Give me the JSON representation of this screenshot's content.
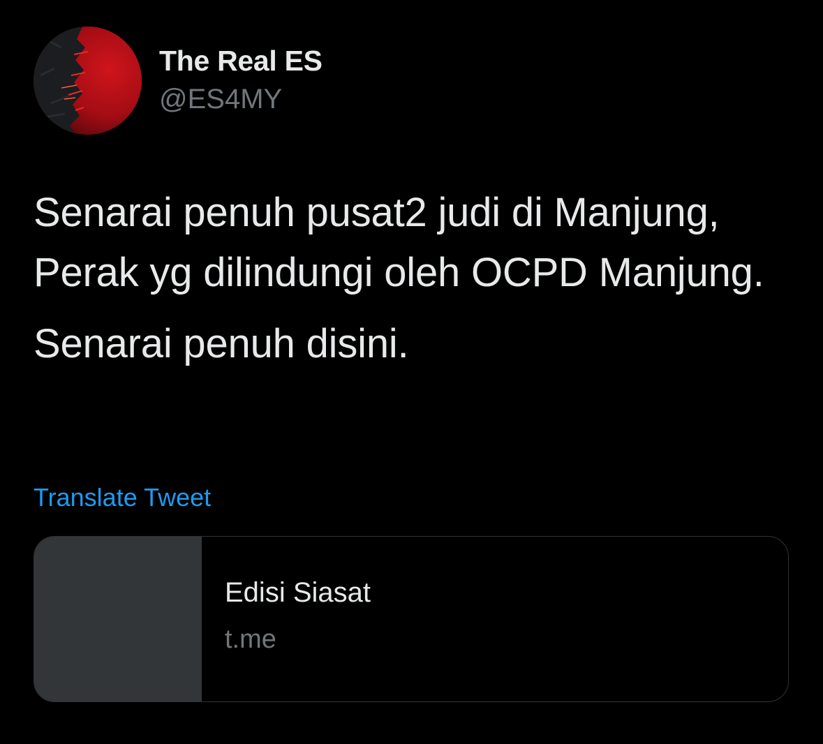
{
  "author": {
    "display_name": "The Real ES",
    "handle": "@ES4MY",
    "avatar_icon": "red-black-abstract-avatar"
  },
  "tweet": {
    "text_paragraph_1": "Senarai penuh pusat2 judi di Manjung, Perak yg dilindungi oleh OCPD Manjung.",
    "text_paragraph_2": "Senarai penuh disini.",
    "translate_label": "Translate Tweet"
  },
  "link_card": {
    "title": "Edisi Siasat",
    "domain": "t.me"
  },
  "colors": {
    "background": "#000000",
    "primary_text": "#e7e9ea",
    "secondary_text": "#71767b",
    "link_blue": "#1d9bf0",
    "card_border": "#2f3336",
    "card_thumb": "#323638"
  }
}
